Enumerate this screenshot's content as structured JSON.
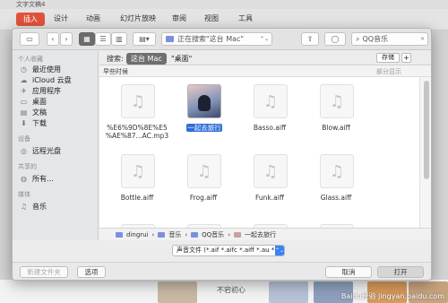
{
  "app": {
    "window_title": "文字文稿4",
    "ribbon_tabs": [
      "插入",
      "设计",
      "动画",
      "幻灯片放映",
      "审阅",
      "视图",
      "工具"
    ],
    "bottom_caption": "不宕初心"
  },
  "toolbar": {
    "sidebar_toggle": "▭",
    "back": "‹",
    "forward": "›",
    "view_icon": "▦",
    "view_list": "☰",
    "view_columns": "▥",
    "view_gallery": "▤▾",
    "location": "正在搜索\"这台 Mac\"",
    "location_arrow": "⌃⌄",
    "share": "⇪",
    "tag": "◯",
    "search_icon": "⌕",
    "search_value": "QQ音乐",
    "clear": "✕"
  },
  "sidebar": {
    "sections": [
      {
        "title": "个人收藏",
        "items": [
          {
            "label": "最近使用",
            "icon": "clock-icon",
            "glyph": "◷"
          },
          {
            "label": "iCloud 云盘",
            "icon": "cloud-icon",
            "glyph": "☁"
          },
          {
            "label": "应用程序",
            "icon": "applications-icon",
            "glyph": "✈"
          },
          {
            "label": "桌面",
            "icon": "desktop-icon",
            "glyph": "▭"
          },
          {
            "label": "文稿",
            "icon": "document-icon",
            "glyph": "▤"
          },
          {
            "label": "下载",
            "icon": "download-icon",
            "glyph": "⬇"
          }
        ]
      },
      {
        "title": "设备",
        "items": [
          {
            "label": "远程光盘",
            "icon": "disc-icon",
            "glyph": "◎"
          }
        ]
      },
      {
        "title": "共享的",
        "items": [
          {
            "label": "所有…",
            "icon": "network-icon",
            "glyph": "◍"
          }
        ]
      },
      {
        "title": "媒体",
        "items": [
          {
            "label": "音乐",
            "icon": "music-icon",
            "glyph": "♫"
          }
        ]
      }
    ]
  },
  "search_scope": {
    "label": "搜索:",
    "this_mac": "这台 Mac",
    "desktop": "\"桌面\"",
    "save": "存储",
    "plus": "+"
  },
  "results": {
    "section_title": "早些时候",
    "show_less": "部分显示",
    "files": [
      {
        "name": "%E6%9D%8E%E5\n%AE%87...AC.mp3",
        "kind": "music"
      },
      {
        "name": "一起去旅行",
        "kind": "album",
        "selected": true
      },
      {
        "name": "Basso.aiff",
        "kind": "music"
      },
      {
        "name": "Blow.aiff",
        "kind": "music"
      },
      {
        "name": "Bottle.aiff",
        "kind": "music"
      },
      {
        "name": "Frog.aiff",
        "kind": "music"
      },
      {
        "name": "Funk.aiff",
        "kind": "music"
      },
      {
        "name": "Glass.aiff",
        "kind": "music"
      },
      {
        "name": "",
        "kind": "music"
      },
      {
        "name": "",
        "kind": "music"
      },
      {
        "name": "",
        "kind": "music"
      },
      {
        "name": "",
        "kind": "music"
      }
    ]
  },
  "path_bar": {
    "items": [
      "dingrui",
      "音乐",
      "QQ音乐",
      "一起去旅行"
    ],
    "separator": "›"
  },
  "format": {
    "value": "声音文件 (*.aif *.aifc *.aiff *.au *.snd...",
    "arrow": "⌃⌄"
  },
  "buttons": {
    "new_folder": "新建文件夹",
    "options": "选项",
    "cancel": "取消",
    "open": "打开"
  },
  "watermark": "Baidu经验 jingyan.baidu.com",
  "colors": {
    "accent": "#e0533b",
    "selection": "#2f6fd6",
    "folder": "#7b8fe0"
  }
}
